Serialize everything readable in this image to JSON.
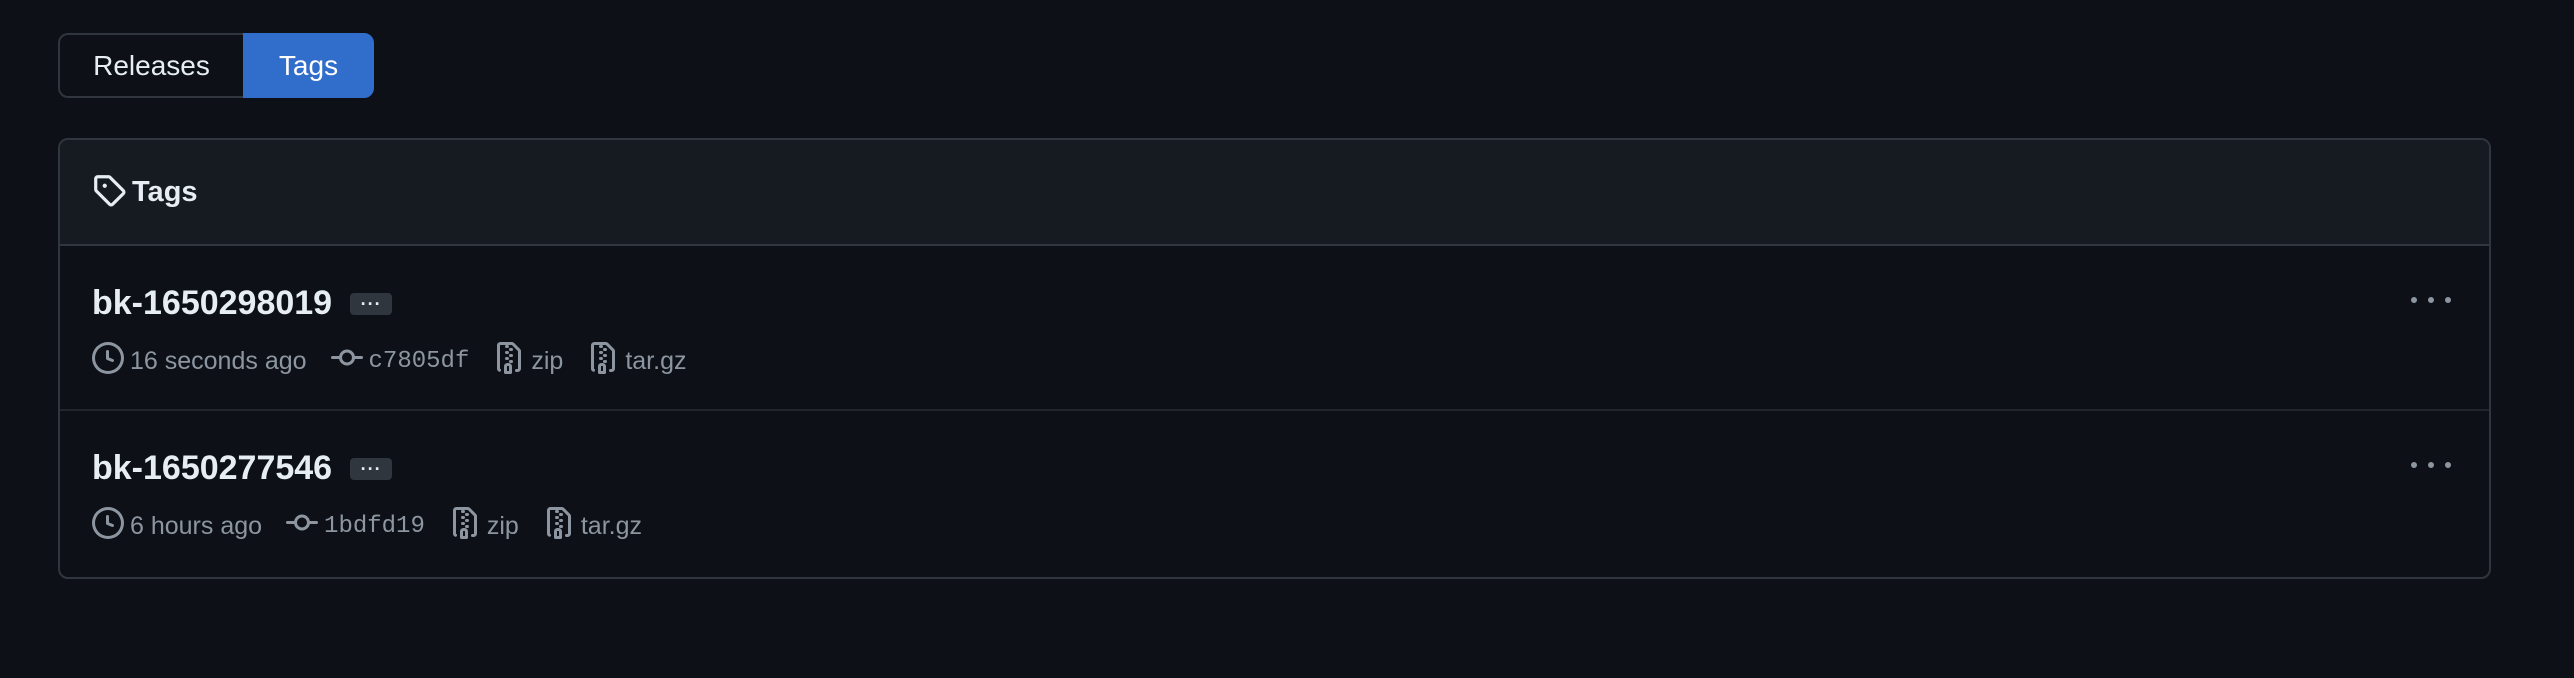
{
  "tabs": {
    "releases_label": "Releases",
    "tags_label": "Tags",
    "active": "Tags",
    "active_color": "#316dca"
  },
  "box": {
    "header_icon": "tag-icon",
    "header_title": "Tags"
  },
  "tags": [
    {
      "name": "bk-1650298019",
      "ellipsis": "···",
      "time": "16 seconds ago",
      "commit": "c7805df",
      "zip": "zip",
      "targz": "tar.gz"
    },
    {
      "name": "bk-1650277546",
      "ellipsis": "···",
      "time": "6 hours ago",
      "commit": "1bdfd19",
      "zip": "zip",
      "targz": "tar.gz"
    }
  ],
  "icons": {
    "time": "clock-icon",
    "commit": "git-commit-icon",
    "archive": "file-zip-icon",
    "menu": "kebab-horizontal-icon"
  },
  "colors": {
    "background": "#0d1117",
    "header_bg": "#161b22",
    "border": "#30363d",
    "muted_text": "#8d96a0"
  }
}
